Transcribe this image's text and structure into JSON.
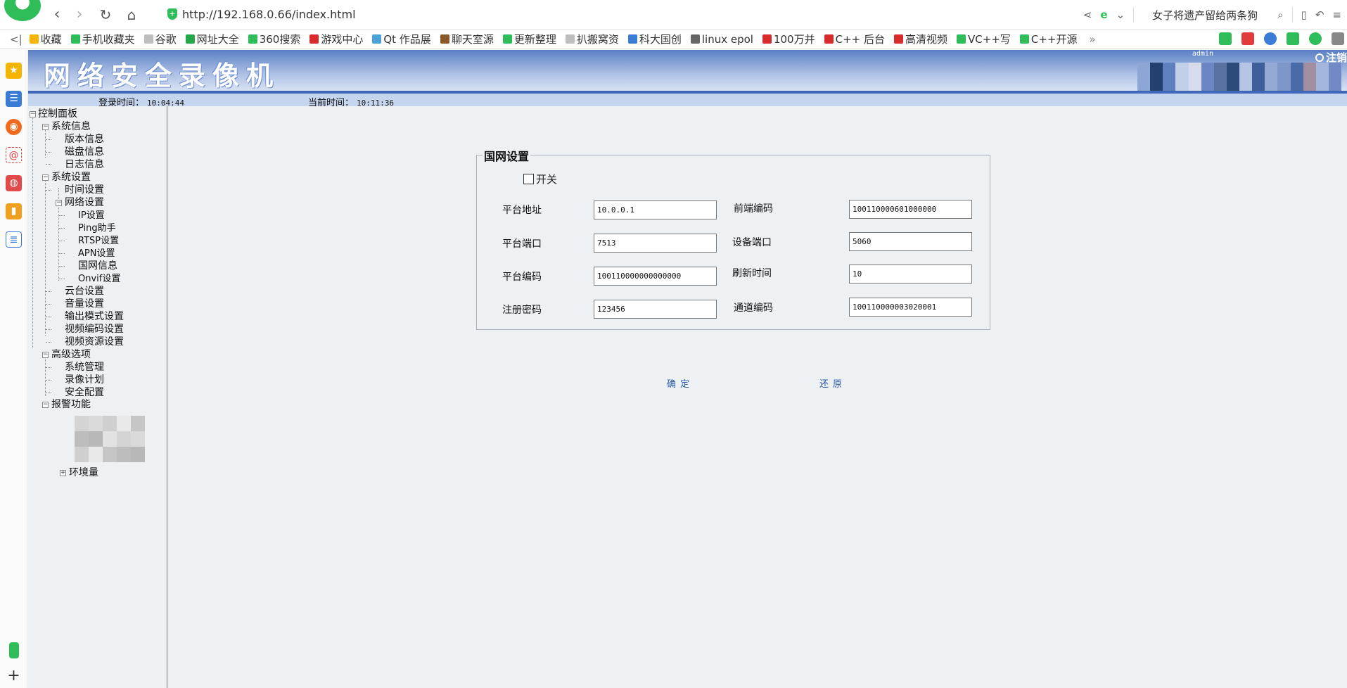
{
  "browser": {
    "url": "http://192.168.0.66/index.html",
    "search_text": "女子将遗产留给两条狗",
    "bookmarks": [
      {
        "label": "收藏",
        "color": "#f5b400"
      },
      {
        "label": "手机收藏夹",
        "color": "#2fbd5a"
      },
      {
        "label": "谷歌",
        "color": "#bdbdbd"
      },
      {
        "label": "网址大全",
        "color": "#26a649"
      },
      {
        "label": "360搜索",
        "color": "#2fbd5a"
      },
      {
        "label": "游戏中心",
        "color": "#d92b2b"
      },
      {
        "label": "Qt 作品展",
        "color": "#4aa3d8"
      },
      {
        "label": "聊天室源",
        "color": "#8a5a2b"
      },
      {
        "label": "更新整理",
        "color": "#2fbd5a"
      },
      {
        "label": "扒搬窝资",
        "color": "#bdbdbd"
      },
      {
        "label": "科大国创",
        "color": "#3a7bd5"
      },
      {
        "label": "linux epol",
        "color": "#666666"
      },
      {
        "label": "100万并",
        "color": "#d92b2b"
      },
      {
        "label": "C++ 后台",
        "color": "#d92b2b"
      },
      {
        "label": "高清视频",
        "color": "#d92b2b"
      },
      {
        "label": "VC++写",
        "color": "#2fbd5a"
      },
      {
        "label": "C++开源",
        "color": "#2fbd5a"
      }
    ]
  },
  "header": {
    "title": "网络安全录像机",
    "user": "admin",
    "logout": "注销"
  },
  "info": {
    "login_label": "登录时间：",
    "login_time": "10:04:44",
    "current_label": "当前时间：",
    "current_time": "10:11:36"
  },
  "tree": {
    "root": "控制面板",
    "sysinfo": "系统信息",
    "version": "版本信息",
    "disk": "磁盘信息",
    "log": "日志信息",
    "sysset": "系统设置",
    "time": "时间设置",
    "network": "网络设置",
    "ip": "IP设置",
    "ping": "Ping助手",
    "rtsp": "RTSP设置",
    "apn": "APN设置",
    "gw": "国网信息",
    "onvif": "Onvif设置",
    "ptz": "云台设置",
    "volume": "音量设置",
    "output": "输出模式设置",
    "venc": "视频编码设置",
    "vres": "视频资源设置",
    "advanced": "高级选项",
    "sysmgr": "系统管理",
    "record": "录像计划",
    "security": "安全配置",
    "alarm": "报警功能",
    "env": "环境量"
  },
  "form": {
    "legend": "国网设置",
    "switch_label": "开关",
    "platform_addr_label": "平台地址",
    "platform_addr": "10.0.0.1",
    "front_code_label": "前端编码",
    "front_code": "100110000601000000",
    "platform_port_label": "平台端口",
    "platform_port": "7513",
    "device_port_label": "设备端口",
    "device_port": "5060",
    "platform_code_label": "平台编码",
    "platform_code": "100110000000000000",
    "refresh_label": "刷新时间",
    "refresh": "10",
    "reg_pwd_label": "注册密码",
    "reg_pwd": "123456",
    "channel_code_label": "通道编码",
    "channel_code": "100110000003020001",
    "ok": "确定",
    "restore": "还原"
  },
  "colors": {
    "banner": "#5a7fc4",
    "infobar": "#c6d5ee",
    "content_bg": "#eef1f3",
    "accent_green": "#2fbd5a"
  }
}
